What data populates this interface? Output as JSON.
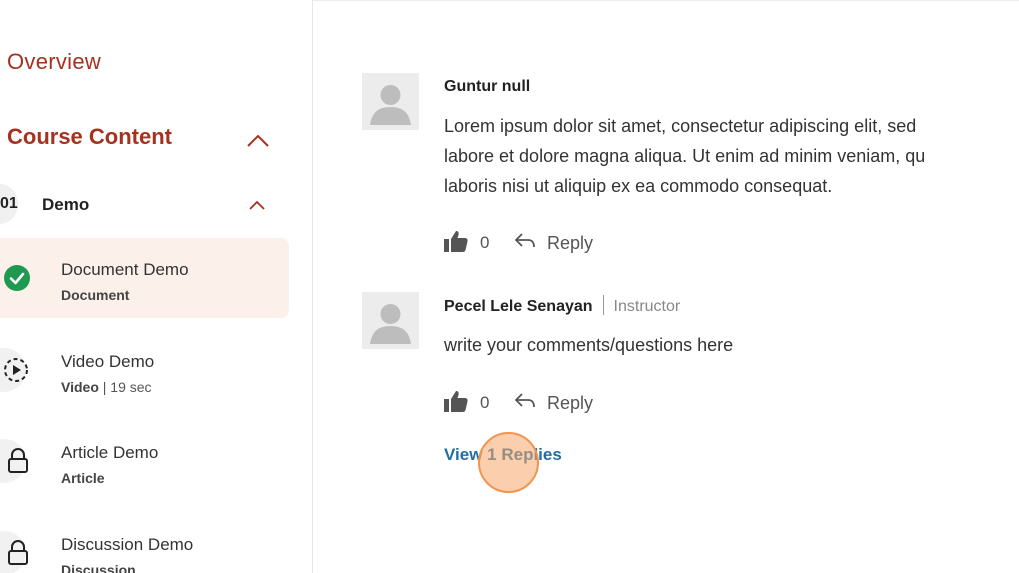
{
  "sidebar": {
    "overview_label": "Overview",
    "course_content_title": "Course Content",
    "section": {
      "number": "01",
      "title": "Demo"
    },
    "lessons": [
      {
        "title": "Document Demo",
        "type": "Document",
        "duration": "",
        "status": "completed"
      },
      {
        "title": "Video Demo",
        "type": "Video",
        "duration": " | 19 sec",
        "status": "unlocked"
      },
      {
        "title": "Article Demo",
        "type": "Article",
        "duration": "",
        "status": "locked"
      },
      {
        "title": "Discussion Demo",
        "type": "Discussion",
        "duration": "",
        "status": "locked"
      }
    ]
  },
  "comments": [
    {
      "author": "Guntur null",
      "role": "",
      "lines": [
        "Lorem ipsum dolor sit amet, consectetur adipiscing elit, sed",
        "labore et dolore magna aliqua. Ut enim ad minim veniam, qu",
        "laboris nisi ut aliquip ex ea commodo consequat."
      ],
      "likes": "0",
      "reply_label": "Reply"
    },
    {
      "author": "Pecel Lele Senayan",
      "role": "Instructor",
      "lines": [
        "write your comments/questions here"
      ],
      "likes": "0",
      "reply_label": "Reply"
    }
  ],
  "view_replies_label": "View 1 Replies",
  "colors": {
    "accent": "#a4321f",
    "link": "#1d6fa5",
    "active_bg": "#fbf0ea",
    "check_green": "#1e9a50"
  }
}
